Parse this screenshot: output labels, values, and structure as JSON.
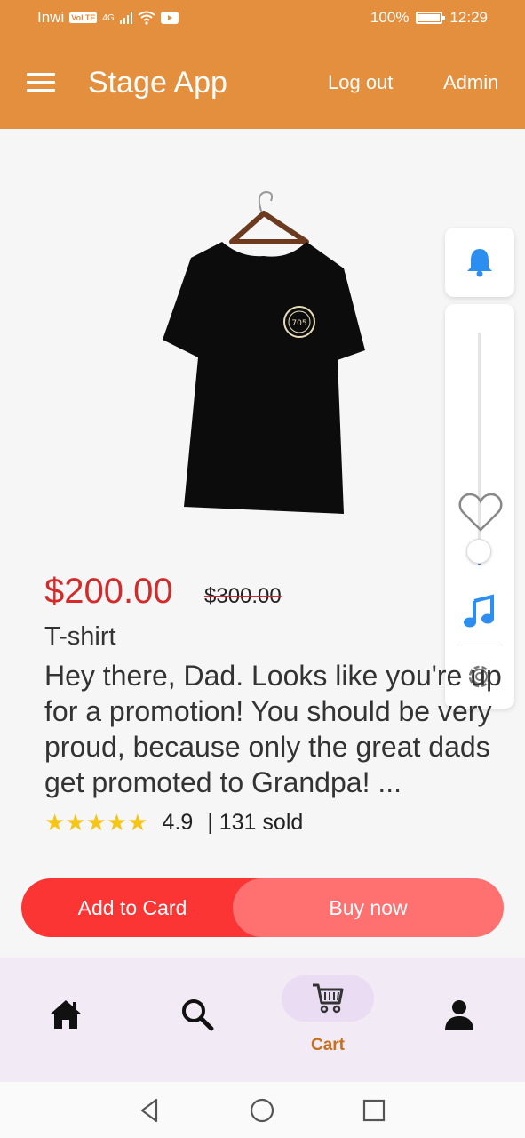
{
  "status_bar": {
    "carrier": "Inwi",
    "volte": "VoLTE",
    "network": "4G",
    "battery": "100%",
    "time": "12:29"
  },
  "app_bar": {
    "title": "Stage App",
    "logout_label": "Log out",
    "admin_label": "Admin"
  },
  "product": {
    "price": "$200.00",
    "old_price": "$300.00",
    "name": "T-shirt",
    "description": "Hey there, Dad. Looks like you're up for a promotion! You should be very proud, because only the great dads get promoted to Grandpa! ...",
    "stars": "★★★★★",
    "rating": "4.9",
    "sold": "| 131 sold",
    "shirt_logo_text": "705"
  },
  "side_panel": {
    "slider_value": 0.1
  },
  "actions": {
    "add_label": "Add to Card",
    "buy_label": "Buy now"
  },
  "bottom_nav": {
    "items": [
      {
        "icon": "home-icon"
      },
      {
        "icon": "search-icon"
      },
      {
        "icon": "cart-icon",
        "label": "Cart",
        "active": true
      },
      {
        "icon": "person-icon"
      }
    ]
  },
  "colors": {
    "app_bar": "#e38f3d",
    "price": "#d12b2b",
    "add_button": "#fb3434",
    "buy_button": "#ff7170",
    "accent_blue": "#3a8ee6",
    "cart_label": "#c4701f"
  }
}
